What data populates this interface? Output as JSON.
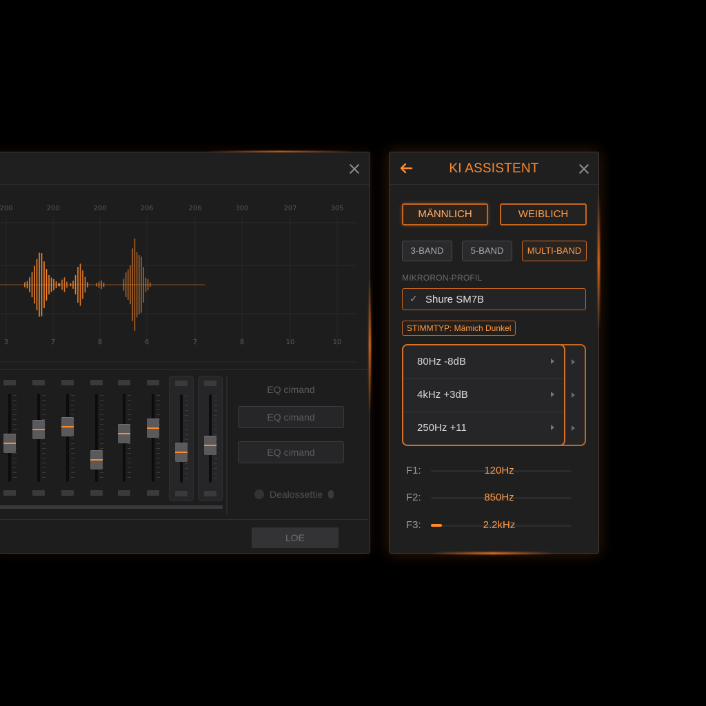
{
  "eq_window": {
    "close_icon": "close-icon",
    "waveform": {
      "x_ticks_top": [
        "200",
        "200",
        "200",
        "206",
        "206",
        "300",
        "207",
        "305"
      ],
      "x_ticks_bottom": [
        "3",
        "7",
        "8",
        "6",
        "7",
        "8",
        "10",
        "10"
      ],
      "color": "#ff8a2a"
    },
    "faders": [
      {
        "level": 0.42
      },
      {
        "level": 0.62
      },
      {
        "level": 0.66
      },
      {
        "level": 0.18
      },
      {
        "level": 0.56
      },
      {
        "level": 0.64
      },
      {
        "level": 0.3
      },
      {
        "level": 0.4
      }
    ],
    "side": {
      "label": "EQ cimand",
      "buttons": [
        "EQ cimand",
        "EQ cimand"
      ],
      "toggle_label": "Dealossettie"
    },
    "footer_button": "LOE"
  },
  "ki_panel": {
    "title": "KI ASSISTENT",
    "back_icon": "arrow-left-icon",
    "close_icon": "close-icon",
    "gender": {
      "male": "MÄNNLICH",
      "female": "WEIBLICH",
      "selected": "male"
    },
    "bands": {
      "b3": "3-BAND",
      "b5": "5-BAND",
      "multi": "MULTI-BAND",
      "selected": "multi"
    },
    "mic_profile": {
      "label": "MIKRORON-PROFIL",
      "value": "Shure SM7B"
    },
    "voice_type": "STIMMTYP: Mämich Dunkel",
    "suggestions": [
      "80Hz  -8dB",
      "4kHz  +3dB",
      "250Hz  +11"
    ],
    "formants": [
      {
        "label": "F1:",
        "value": "120Hz",
        "level": 0.0
      },
      {
        "label": "F2:",
        "value": "850Hz",
        "level": 0.0
      },
      {
        "label": "F3:",
        "value": "2.2kHz",
        "level": 0.08
      }
    ],
    "accent_color": "#ff8a2a"
  }
}
